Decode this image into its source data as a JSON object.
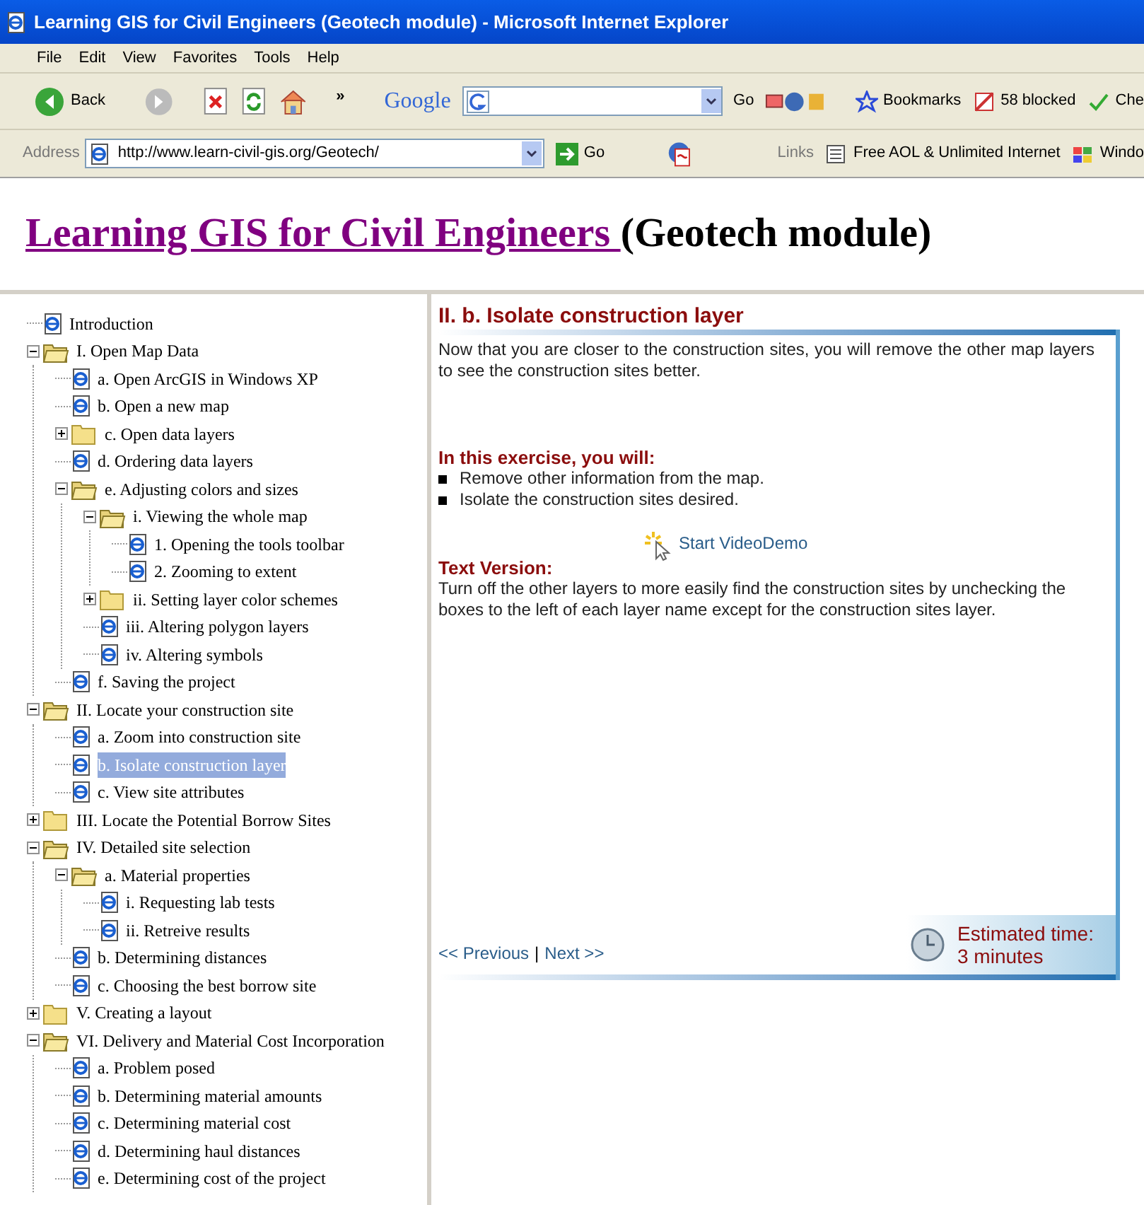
{
  "window": {
    "title": "Learning GIS for Civil Engineers (Geotech module) - Microsoft Internet Explorer"
  },
  "menu": [
    "File",
    "Edit",
    "View",
    "Favorites",
    "Tools",
    "Help"
  ],
  "toolbar": {
    "back": "Back",
    "overflow": "»",
    "google": "Google",
    "go": "Go",
    "bookmarks": "Bookmarks",
    "blocked": "58 blocked",
    "check": "Che"
  },
  "address_bar": {
    "label": "Address",
    "url": "http://www.learn-civil-gis.org/Geotech/",
    "go": "Go",
    "links_label": "Links",
    "links": [
      "Free AOL & Unlimited Internet",
      "Windo"
    ]
  },
  "page_title": {
    "link": "Learning GIS for Civil Engineers ",
    "rest": "(Geotech module)"
  },
  "tree": [
    {
      "kind": "page",
      "label": "Introduction",
      "selected": false
    },
    {
      "kind": "folder",
      "label": "I. Open Map Data",
      "expanded": true,
      "children": [
        {
          "kind": "page",
          "label": "a. Open ArcGIS in Windows XP",
          "selected": false
        },
        {
          "kind": "page",
          "label": "b. Open a new map",
          "selected": false
        },
        {
          "kind": "folder",
          "label": "c. Open data layers",
          "expanded": false
        },
        {
          "kind": "page",
          "label": "d. Ordering data layers",
          "selected": false
        },
        {
          "kind": "folder",
          "label": "e. Adjusting colors and sizes",
          "expanded": true,
          "children": [
            {
              "kind": "folder",
              "label": "i. Viewing the whole map",
              "expanded": true,
              "children": [
                {
                  "kind": "page",
                  "label": "1. Opening the tools toolbar",
                  "selected": false
                },
                {
                  "kind": "page",
                  "label": "2. Zooming to extent",
                  "selected": false
                }
              ]
            },
            {
              "kind": "folder",
              "label": "ii. Setting layer color schemes",
              "expanded": false
            },
            {
              "kind": "page",
              "label": "iii. Altering polygon layers",
              "selected": false
            },
            {
              "kind": "page",
              "label": "iv. Altering symbols",
              "selected": false
            }
          ]
        },
        {
          "kind": "page",
          "label": "f. Saving the project",
          "selected": false
        }
      ]
    },
    {
      "kind": "folder",
      "label": "II. Locate your construction site",
      "expanded": true,
      "children": [
        {
          "kind": "page",
          "label": "a. Zoom into construction site",
          "selected": false
        },
        {
          "kind": "page",
          "label": "b. Isolate construction layer",
          "selected": true
        },
        {
          "kind": "page",
          "label": "c. View site attributes",
          "selected": false
        }
      ]
    },
    {
      "kind": "folder",
      "label": "III. Locate the Potential Borrow Sites",
      "expanded": false
    },
    {
      "kind": "folder",
      "label": "IV. Detailed site selection",
      "expanded": true,
      "children": [
        {
          "kind": "folder",
          "label": "a. Material properties",
          "expanded": true,
          "children": [
            {
              "kind": "page",
              "label": "i. Requesting lab tests",
              "selected": false
            },
            {
              "kind": "page",
              "label": "ii. Retreive results",
              "selected": false
            }
          ]
        },
        {
          "kind": "page",
          "label": "b. Determining distances",
          "selected": false
        },
        {
          "kind": "page",
          "label": "c. Choosing the best borrow site",
          "selected": false
        }
      ]
    },
    {
      "kind": "folder",
      "label": "V. Creating a layout",
      "expanded": false
    },
    {
      "kind": "folder",
      "label": "VI. Delivery and Material Cost Incorporation",
      "expanded": true,
      "children": [
        {
          "kind": "page",
          "label": "a. Problem posed",
          "selected": false
        },
        {
          "kind": "page",
          "label": "b. Determining material amounts",
          "selected": false
        },
        {
          "kind": "page",
          "label": "c. Determining material cost",
          "selected": false
        },
        {
          "kind": "page",
          "label": "d. Determining haul distances",
          "selected": false
        },
        {
          "kind": "page",
          "label": "e. Determining cost of the project",
          "selected": false
        }
      ]
    }
  ],
  "lesson": {
    "heading": "II. b. Isolate construction layer",
    "intro": "Now that you are closer to the construction sites, you will remove the other map layers to see the construction sites better.",
    "exercise_heading": "In this exercise, you will:",
    "bullets": [
      "Remove other information from the map.",
      "Isolate the construction sites desired."
    ],
    "video_link": "Start VideoDemo",
    "text_version_heading": "Text Version:",
    "text_version": "Turn off the other layers to more easily find the construction sites by unchecking the boxes to the left of each layer name except for the construction sites layer.",
    "previous": "<< Previous",
    "separator": "|",
    "next": "Next >>",
    "estimated_label": "Estimated time:",
    "estimated_value": "3 minutes"
  }
}
